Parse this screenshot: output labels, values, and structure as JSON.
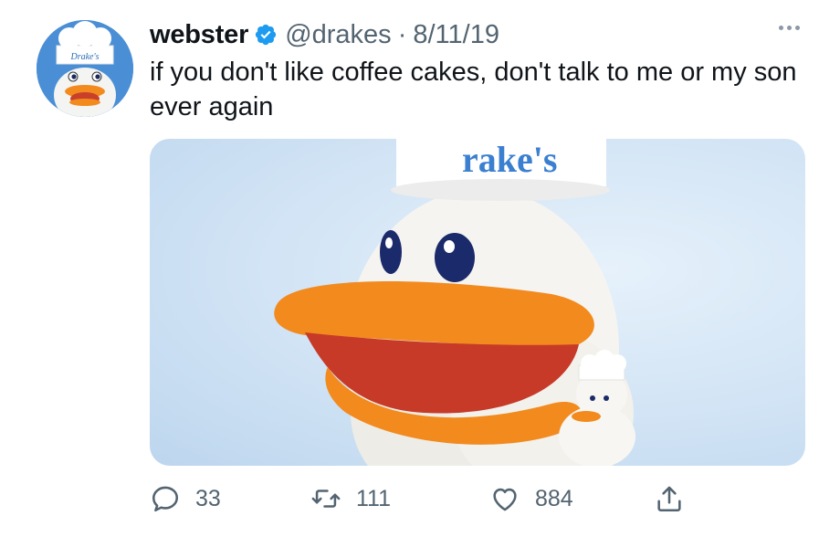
{
  "tweet": {
    "author": {
      "name": "webster",
      "handle": "@drakes",
      "verified": true,
      "avatar_icon": "drakes-duck-mascot-avatar",
      "avatar_text": "Drake's"
    },
    "separator": "·",
    "date": "8/11/19",
    "text": "if you don't like coffee cakes, don't talk to me or my son ever again",
    "media": {
      "description_icon": "duck-mascot-photo",
      "hat_text": "rake's"
    },
    "stats": {
      "replies": "33",
      "retweets": "111",
      "likes": "884"
    },
    "colors": {
      "verified": "#1d9bf0",
      "secondary_text": "#536471",
      "beak": "#f28a1e",
      "background": "#cfe2f4"
    }
  }
}
